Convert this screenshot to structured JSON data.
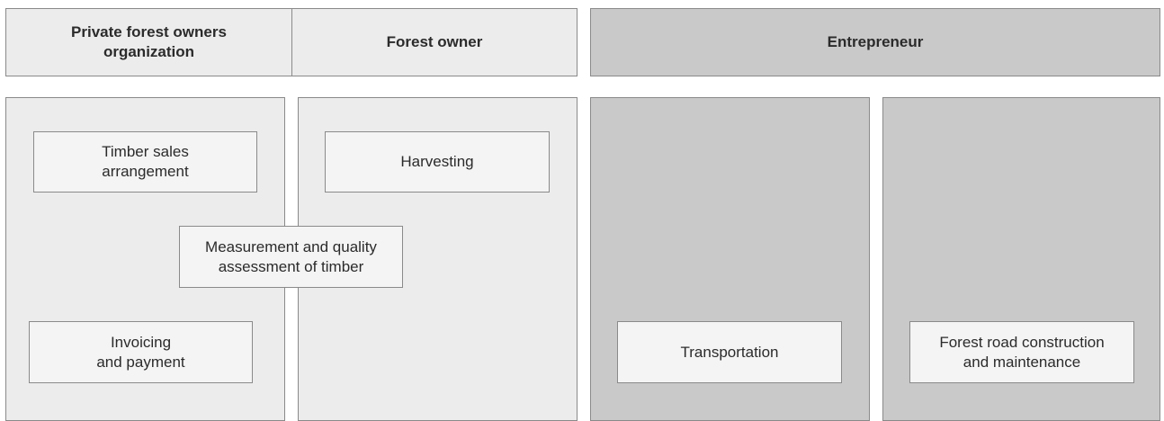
{
  "headers": {
    "private_org": "Private forest owners\norganization",
    "forest_owner": "Forest owner",
    "entrepreneur": "Entrepreneur"
  },
  "tasks": {
    "timber_sales": "Timber sales\narrangement",
    "harvesting": "Harvesting",
    "measurement": "Measurement and quality\nassessment of timber",
    "invoicing": "Invoicing\nand payment",
    "transportation": "Transportation",
    "forest_road": "Forest road construction\nand maintenance"
  },
  "colors": {
    "light_fill": "#ececec",
    "dark_fill": "#c9c9c9",
    "border": "#8a8a8a",
    "task_fill": "#f4f4f4"
  }
}
